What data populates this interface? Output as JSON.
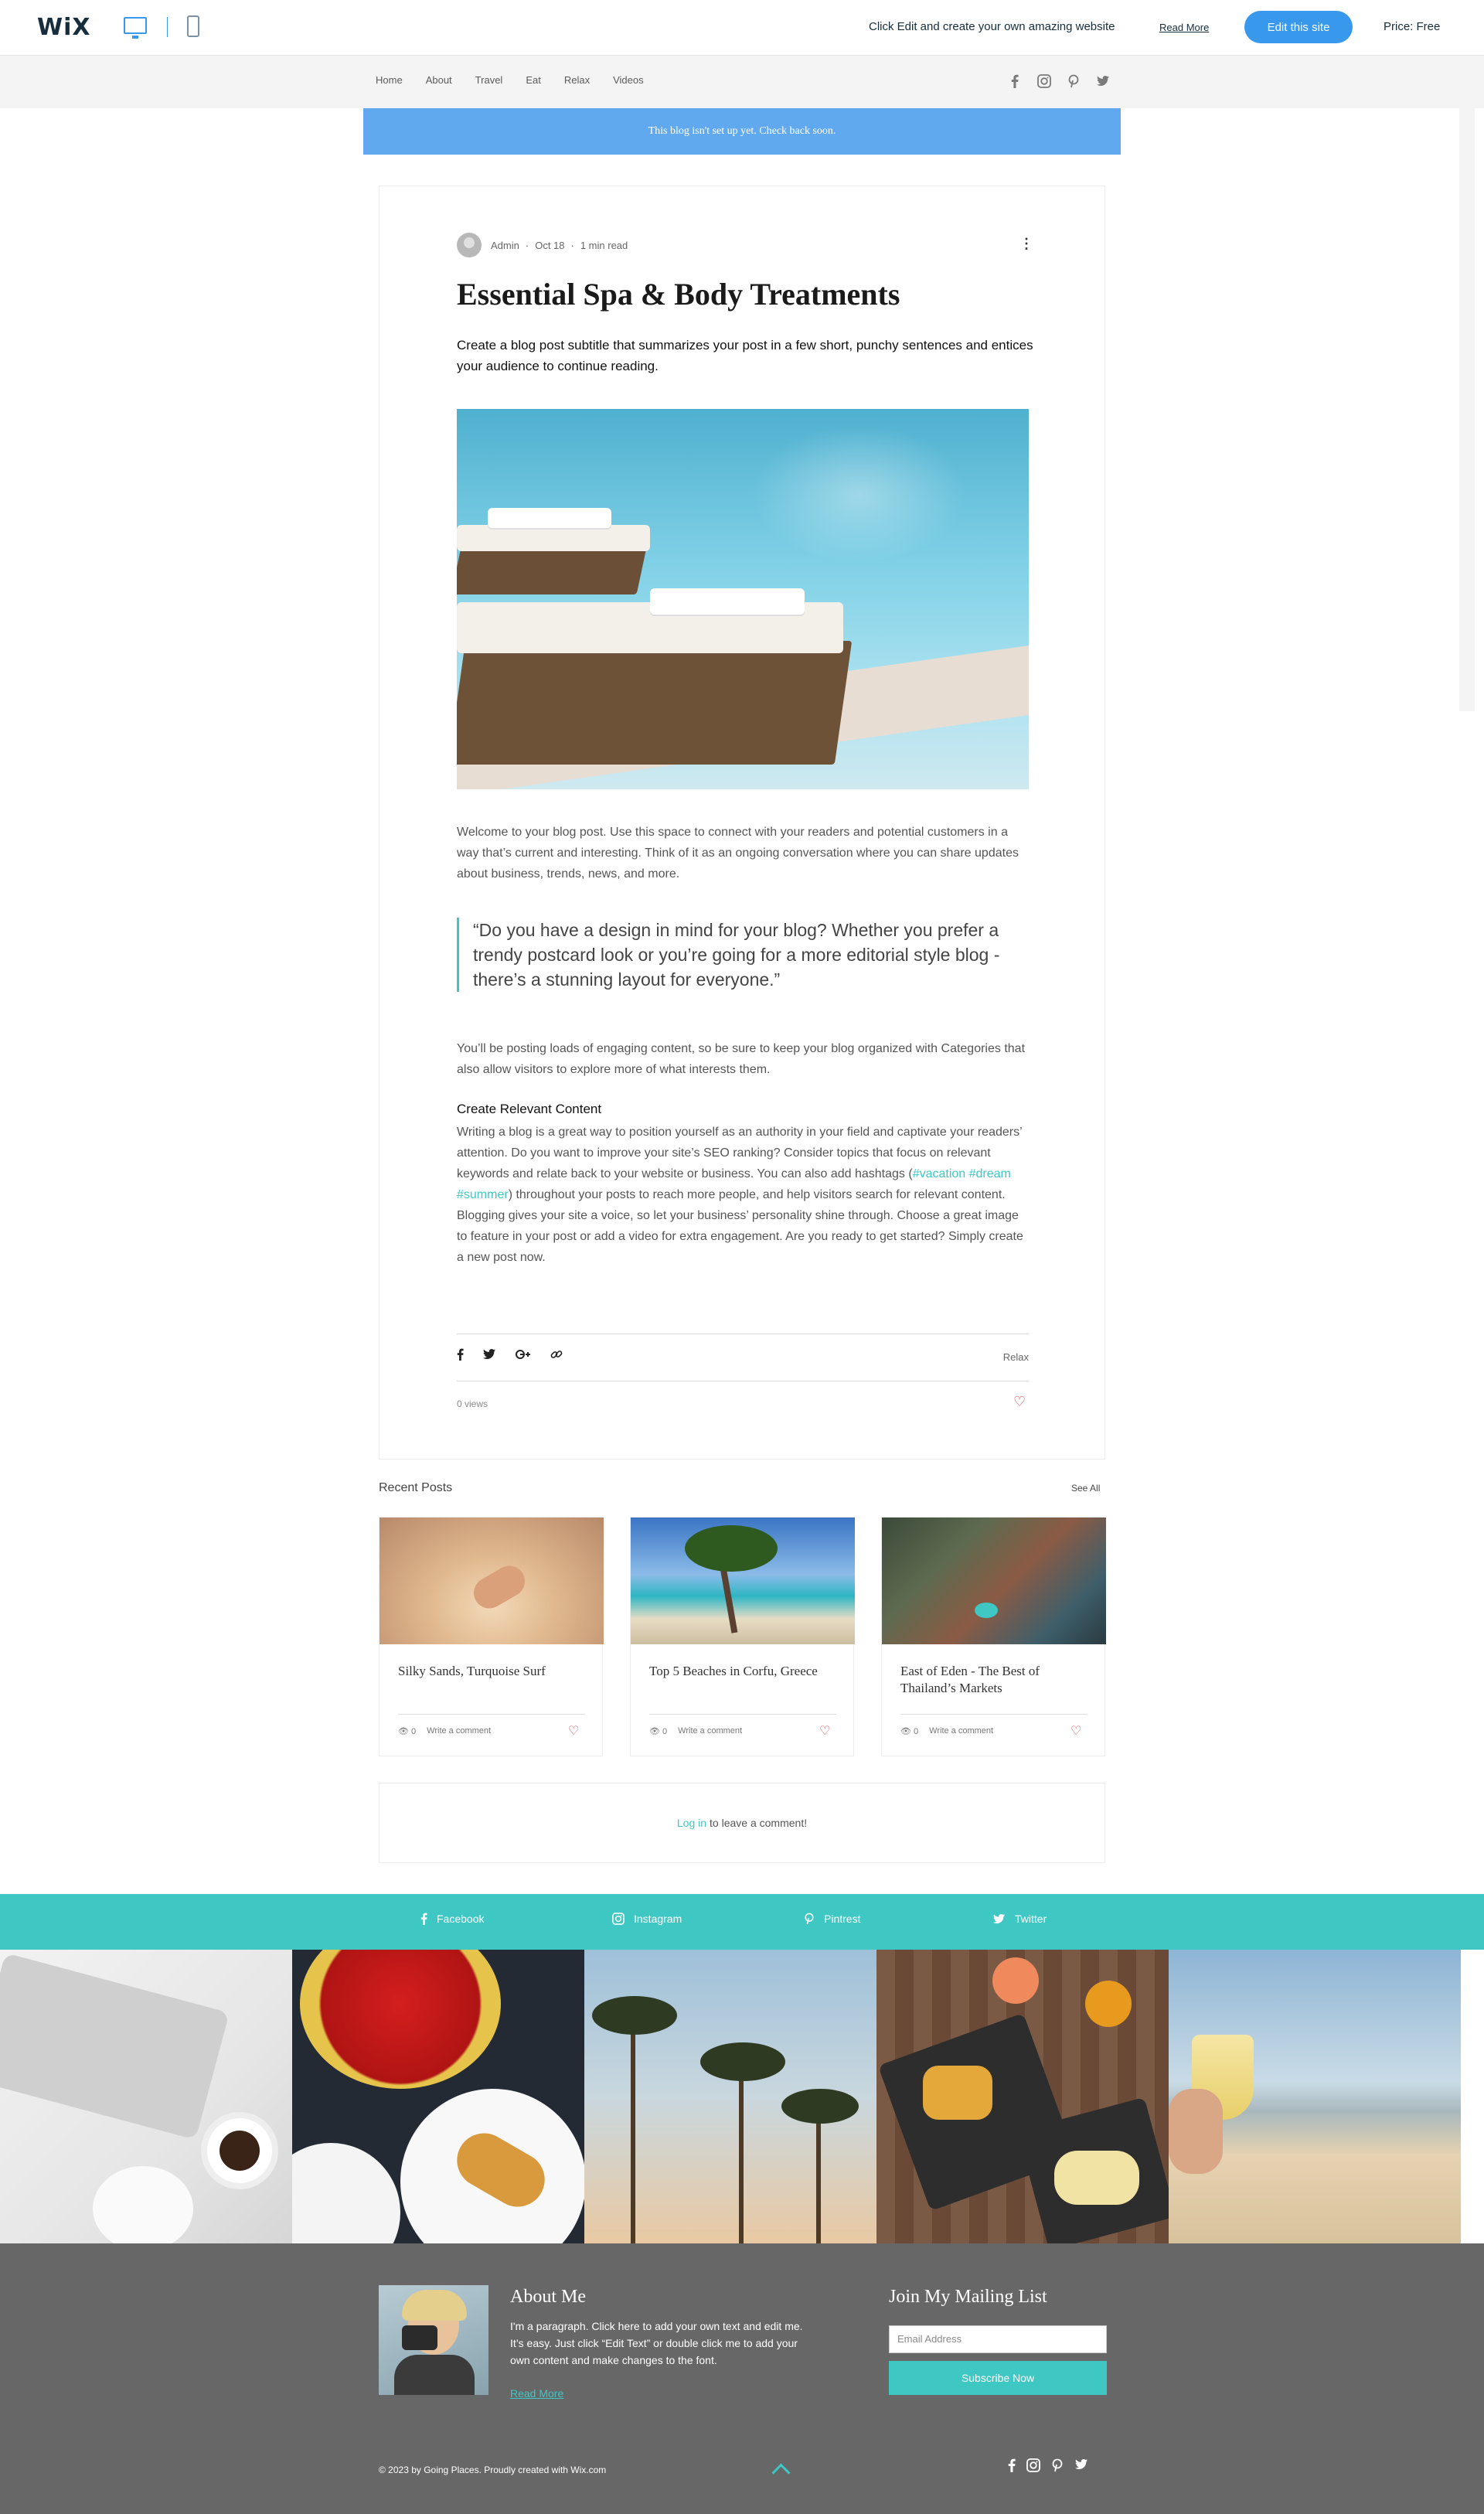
{
  "wix_bar": {
    "logo": "WiX",
    "message": "Click Edit and create your own amazing website",
    "read_more": "Read More",
    "edit_button": "Edit this site",
    "price": "Price: Free"
  },
  "nav": {
    "items": [
      "Home",
      "About",
      "Travel",
      "Eat",
      "Relax",
      "Videos"
    ],
    "social_icons": [
      "facebook-icon",
      "instagram-icon",
      "pinterest-icon",
      "twitter-icon"
    ]
  },
  "notice": "This blog isn't set up yet. Check back soon.",
  "post": {
    "author": "Admin",
    "date": "Oct 18",
    "read_time": "1 min read",
    "title": "Essential Spa & Body Treatments",
    "subtitle": "Create a blog post subtitle that summarizes your post in a few short, punchy sentences and entices your audience to continue reading.",
    "paragraph1": "Welcome to your blog post. Use this space to connect with your readers and potential customers in a way that’s current and interesting. Think of it as an ongoing conversation where you can share updates about business, trends, news, and more.",
    "quote": "“Do you have a design in mind for your blog? Whether you prefer a trendy postcard look or you’re going for a more editorial style blog - there’s a stunning layout for everyone.”",
    "paragraph2": "You’ll be posting loads of engaging content, so be sure to keep your blog organized with Categories that also allow visitors to explore more of what interests them.",
    "heading": "Create Relevant Content",
    "paragraph3_a": "Writing a blog is a great way to position yourself as an authority in your field and captivate your readers’ attention. Do you want to improve your site’s SEO ranking? Consider topics that focus on relevant keywords and relate back to your website or business. You can also add hashtags (",
    "paragraph3_tags": "#vacation #dream #summer",
    "paragraph3_b": ") throughout your posts to reach more people, and help visitors search for relevant content.",
    "paragraph3_c": "Blogging gives your site a voice, so let your business’ personality shine through. Choose a great image to feature in your post or add a video for extra engagement. Are you ready to get started? Simply create a new post now.",
    "category": "Relax",
    "views": "0 views",
    "share_icons": [
      "facebook-icon",
      "twitter-icon",
      "google-plus-icon",
      "link-icon"
    ]
  },
  "recent": {
    "title": "Recent Posts",
    "see_all": "See All",
    "posts": [
      {
        "title": "Silky Sands, Turquoise Surf",
        "views": "0",
        "comment": "Write a comment"
      },
      {
        "title": "Top 5 Beaches in Corfu, Greece",
        "views": "0",
        "comment": "Write a comment"
      },
      {
        "title": "East of Eden - The Best of Thailand’s Markets",
        "views": "0",
        "comment": "Write a comment"
      }
    ]
  },
  "comments": {
    "login": "Log in",
    "rest": "to leave a comment!"
  },
  "strip": {
    "facebook": "Facebook",
    "instagram": "Instagram",
    "pintrest": "Pintrest",
    "twitter": "Twitter"
  },
  "footer": {
    "about_title": "About Me",
    "about_text": "I'm a paragraph. Click here to add your own text and edit me. It’s easy. Just click “Edit Text” or double click me to add your own content and make changes to the font.",
    "about_read": "Read More",
    "mail_title": "Join My Mailing List",
    "mail_placeholder": "Email Address",
    "mail_button": "Subscribe Now",
    "copyright": "© 2023 by Going Places. Proudly created with Wix.com"
  },
  "colors": {
    "accent": "#3ec7c3",
    "wix_blue": "#3899ec",
    "notice": "#60a9ee",
    "footer": "#676767",
    "heart": "#e3484b"
  }
}
